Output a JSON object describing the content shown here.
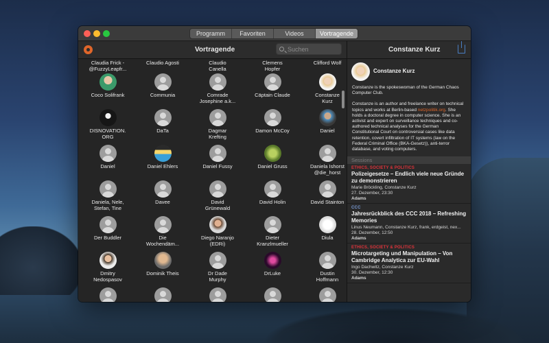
{
  "desktop": {
    "wallpaper": "catalina-island"
  },
  "tabs": [
    {
      "label": "Programm",
      "active": false
    },
    {
      "label": "Favoriten",
      "active": false
    },
    {
      "label": "Videos",
      "active": false
    },
    {
      "label": "Vortragende",
      "active": true
    }
  ],
  "toolbar": {
    "settings_icon": "gear-icon",
    "title": "Vortragende",
    "search_placeholder": "Suchen",
    "detail_title": "Constanze Kurz",
    "share_icon": "share-icon"
  },
  "speakers": [
    {
      "name": "Claudia Frick -\n@FuzzyLeapfr...",
      "avatar": "none"
    },
    {
      "name": "Claudio Agosti",
      "avatar": "none"
    },
    {
      "name": "Claudio\nCanella",
      "avatar": "none"
    },
    {
      "name": "Clemens\nHopfer",
      "avatar": "none"
    },
    {
      "name": "Clifford Wolf",
      "avatar": "none"
    },
    {
      "name": "Coco Solifrank",
      "avatar": "photo-green"
    },
    {
      "name": "Communia",
      "avatar": "default"
    },
    {
      "name": "Comrade\nJosephine a.k...",
      "avatar": "default"
    },
    {
      "name": "Cäptain Claude",
      "avatar": "default"
    },
    {
      "name": "Constanze\nKurz",
      "avatar": "photo-blond"
    },
    {
      "name": "DISNOVATION.\nORG",
      "avatar": "photo-dark"
    },
    {
      "name": "DaTa",
      "avatar": "default"
    },
    {
      "name": "Dagmar\nKrefting",
      "avatar": "default"
    },
    {
      "name": "Damon McCoy",
      "avatar": "default"
    },
    {
      "name": "Daniel",
      "avatar": "photo-rot"
    },
    {
      "name": "Daniel",
      "avatar": "default"
    },
    {
      "name": "Daniel Ehlers",
      "avatar": "photo-pixel"
    },
    {
      "name": "Daniel Fussy",
      "avatar": "default"
    },
    {
      "name": "Daniel Gruss",
      "avatar": "photo-tree"
    },
    {
      "name": "Daniela Ishorst\n@die_horst",
      "avatar": "default"
    },
    {
      "name": "Daniela, Nele,\nStefan, Tine",
      "avatar": "default"
    },
    {
      "name": "Davee",
      "avatar": "default"
    },
    {
      "name": "David\nGrünewald",
      "avatar": "default"
    },
    {
      "name": "David Holin",
      "avatar": "default"
    },
    {
      "name": "David Stainton",
      "avatar": "default"
    },
    {
      "name": "Der Buddler",
      "avatar": "default"
    },
    {
      "name": "Die\nWochendäm...",
      "avatar": "default"
    },
    {
      "name": "Diego Naranjo\n(EDRi)",
      "avatar": "photo-man"
    },
    {
      "name": "Dieter\nKranzlmueller",
      "avatar": "default"
    },
    {
      "name": "Diula",
      "avatar": "photo-cartoon"
    },
    {
      "name": "Dmitry\nNedospasov",
      "avatar": "photo-beard"
    },
    {
      "name": "Dominik Theis",
      "avatar": "photo-bald"
    },
    {
      "name": "Dr Dade\nMurphy",
      "avatar": "default"
    },
    {
      "name": "DrLuke",
      "avatar": "photo-pink"
    },
    {
      "name": "Dustin\nHoffmann",
      "avatar": "default"
    },
    {
      "name": "",
      "avatar": "default"
    },
    {
      "name": "",
      "avatar": "default"
    },
    {
      "name": "",
      "avatar": "default"
    },
    {
      "name": "",
      "avatar": "default"
    },
    {
      "name": "",
      "avatar": "default"
    }
  ],
  "detail": {
    "name": "Constanze Kurz",
    "bio_p1": "Constanze is the spokeswoman of the German Chaos Computer Club.",
    "bio_p2_a": "Constanze is an author and freelance writer on technical topics and works at Berlin-based ",
    "bio_p2_link": "netzpolitik.org",
    "bio_p2_b": ". She holds a doctoral degree in computer science. She is an activist and expert on surveillance techniques and co-authored technical analyses for the German Constitutional Court on controversial cases like data retention, covert infiltration of IT systems (law on the Federal Criminal Office (BKA-Gesetz)), anti-terror database, and voting computers.",
    "sessions_label": "Sessions",
    "sessions": [
      {
        "track": "ETHICS, SOCIETY & POLITICS",
        "track_color": "#e0333a",
        "title": "Polizeigesetze – Endlich viele neue Gründe zu demonstrieren",
        "people": "Marie Bröckling, Constanze Kurz",
        "when": "27. Dezember, 23:30",
        "room": "Adams"
      },
      {
        "track": "CCC",
        "track_color": "#7a9cd8",
        "title": "Jahresrückblick des CCC 2018 – Refreshing Memories",
        "people": "Linus Neumann, Constanze Kurz, frank, erdgeist, nex...",
        "when": "28. Dezember, 12:50",
        "room": "Adams"
      },
      {
        "track": "ETHICS, SOCIETY & POLITICS",
        "track_color": "#e0333a",
        "title": "Microtargeting und Manipulation – Von Cambridge Analytica zur EU-Wahl",
        "people": "Ingo Dachwitz, Constanze Kurz",
        "when": "30. Dezember, 12:30",
        "room": "Adams"
      }
    ]
  }
}
